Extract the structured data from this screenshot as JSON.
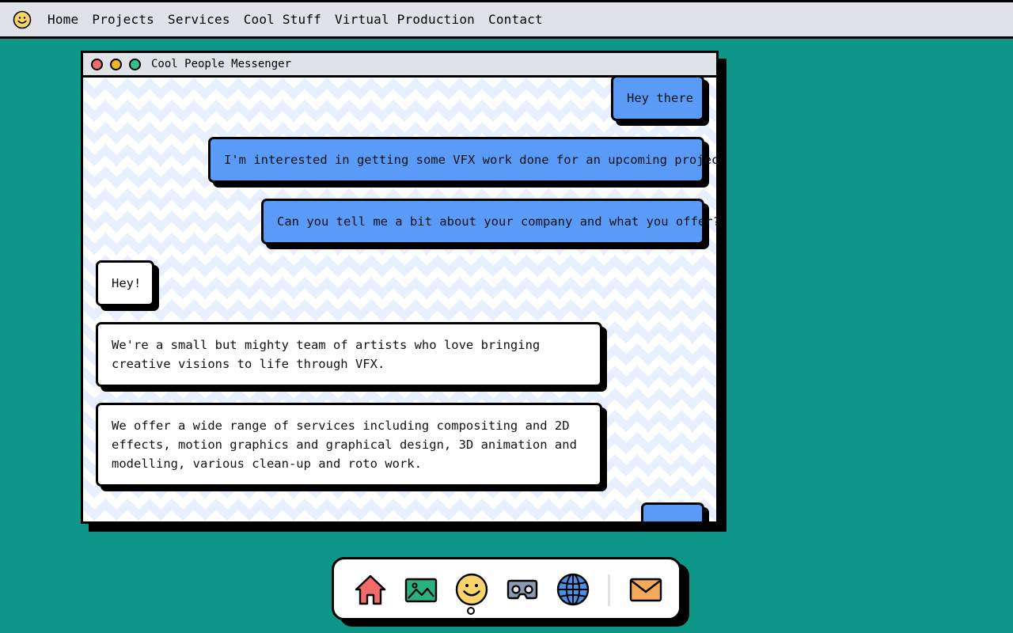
{
  "menu": {
    "logo_icon": "smiley-icon",
    "items": [
      "Home",
      "Projects",
      "Services",
      "Cool Stuff",
      "Virtual Production",
      "Contact"
    ]
  },
  "window": {
    "title": "Cool People Messenger",
    "controls": [
      "close",
      "minimize",
      "maximize"
    ]
  },
  "messages": [
    {
      "from": "user",
      "text": "Hey there"
    },
    {
      "from": "user",
      "text": "I'm interested in getting some VFX work done for an upcoming project."
    },
    {
      "from": "user",
      "text": "Can you tell me a bit about your company and what you offer?"
    },
    {
      "from": "company",
      "text": "Hey!"
    },
    {
      "from": "company",
      "text": "We're a small but mighty team of artists who love bringing creative visions to life through VFX."
    },
    {
      "from": "company",
      "text": "We offer a wide range of services including compositing and 2D effects, motion graphics and graphical design, 3D animation and modelling, various clean-up and roto work."
    },
    {
      "from": "user",
      "text": ""
    }
  ],
  "dock": {
    "items": [
      "home-icon",
      "image-icon",
      "smiley-icon",
      "vr-headset-icon",
      "globe-icon",
      "mail-icon"
    ],
    "active": "smiley-icon"
  },
  "colors": {
    "background": "#0e9688",
    "user_bubble": "#5b9bf8",
    "company_bubble": "#ffffff",
    "chrome": "#dfe2e6"
  }
}
